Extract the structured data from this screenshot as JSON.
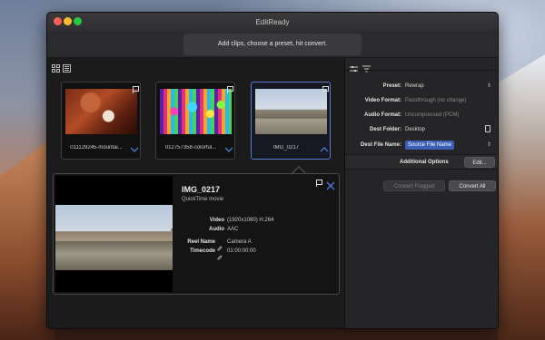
{
  "window": {
    "title": "EditReady"
  },
  "toolbar": {
    "hint": "Add clips, choose a preset, hit convert."
  },
  "clips": [
    {
      "name": "011129245-mountai...",
      "image": "red-mountain-close-up",
      "selected": false
    },
    {
      "name": "012757358-colorful...",
      "image": "colorful-light-bars",
      "selected": false
    },
    {
      "name": "IMG_0217",
      "image": "city-skyline",
      "selected": true
    }
  ],
  "detail": {
    "filename": "IMG_0217",
    "filetype": "QuickTime movie",
    "video_label": "Video",
    "video_value": "(1920x1080) H.264",
    "audio_label": "Audio",
    "audio_value": "AAC",
    "reel_label": "Reel Name",
    "reel_value": "Camera A",
    "timecode_label": "Timecode",
    "timecode_value": "01:00:00:00"
  },
  "settings": {
    "preset_label": "Preset:",
    "preset_value": "Rewrap",
    "video_format_label": "Video Format:",
    "video_format_value": "Passthrough (no change)",
    "audio_format_label": "Audio Format:",
    "audio_format_value": "Uncompressed (PCM)",
    "dest_folder_label": "Dest Folder:",
    "dest_folder_value": "Desktop",
    "dest_file_label": "Dest File Name:",
    "dest_file_token": "Source File Name",
    "additional_options_label": "Additional Options",
    "edit_button": "Edit..."
  },
  "actions": {
    "convert_flagged": "Convert Flagged",
    "convert_all": "Convert All"
  },
  "colors": {
    "accent": "#3c5fb6",
    "selection_border": "#5a7ad0",
    "close": "#fc5f57",
    "minimize": "#fdbc2e",
    "zoom": "#28c840"
  }
}
